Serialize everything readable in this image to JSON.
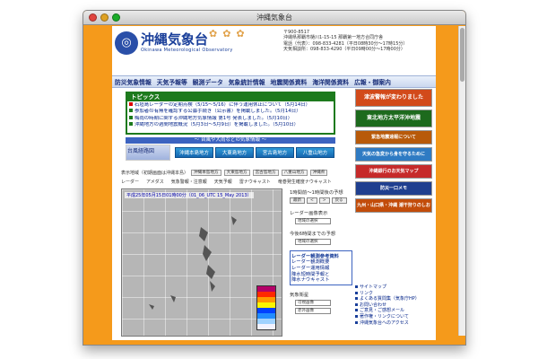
{
  "window": {
    "title": "沖縄気象台"
  },
  "header": {
    "title": "沖縄気象台",
    "subtitle": "Okinawa Meteorological Observatory",
    "contact_lines": [
      "〒900-8517",
      "沖縄県那覇市樋川1-15-15  那覇第一地方合同庁舎",
      "電話（代表）：098-833-4281（平日08時30分〜17時15分）",
      "天気相談所：098-833-4290（平日09時00分〜17時00分）"
    ]
  },
  "nav": {
    "items": [
      "防災気象情報",
      "天気予報等",
      "観測データ",
      "気象統計情報",
      "地震関係資料",
      "海洋関係資料",
      "広報・御案内"
    ]
  },
  "topics": {
    "heading": "トピックス",
    "items": [
      "石垣島レーダーの定期点検（5/15〜5/16）に伴う運用休止について（5月14日）",
      "参加者の有無を確認する公募手続き（公示書）を掲載しました。（5月14日）",
      "梅雨の時期に関する沖縄地方気象情報 第1号 発表しました。（5月10日）",
      "沖縄地方の週間地震概況（5月3日〜5月9日）を掲載しました。（5月10日）"
    ]
  },
  "typhoon": {
    "banner": "〜 台風や大雨などの気象情報 〜",
    "link_label": "台風経路図",
    "regions": [
      "沖縄本島地方",
      "大東島地方",
      "宮古島地方",
      "八重山地方"
    ]
  },
  "area_select": {
    "label": "表示地域（初期画面は沖縄本島）",
    "buttons": [
      "沖縄本島地方",
      "大東島地方",
      "宮古島地方",
      "八重山地方",
      "沖縄県"
    ]
  },
  "menu_row": [
    "レーダー",
    "アメダス",
    "気象警報・注意報",
    "天気予報",
    "雷ナウキャスト",
    "竜巻発生確度ナウキャスト"
  ],
  "map": {
    "stamp": "平成25年05月15日01時00分（01_06_UTC 15_May 2013）"
  },
  "side_controls": {
    "forecast_label": "1時間前〜1時間後の予想",
    "buttons": [
      "最新",
      "<",
      ">",
      "戻る"
    ],
    "radar_display": "レーダー画像表示",
    "select_1": "地域の選択",
    "forecast_6h": "今後6時間までの予想",
    "select_2": "地域の選択",
    "radar_ref_title": "レーダー観測参考資料",
    "radar_ref_links": [
      "レーダー観測概要",
      "レーダー運用情報",
      "降水短時間予報と",
      "降水ナウキャスト"
    ],
    "weather_select_label": "気象衛星",
    "select_3": "可視画像",
    "select_4": "赤外画像"
  },
  "right_ads": [
    {
      "label": "津波警報が変わりました",
      "color": "#d24a1a"
    },
    {
      "label": "東北地方太平洋沖地震",
      "color": "#1d6a1d"
    },
    {
      "label": "緊急地震速報について",
      "color": "#b85a0a"
    },
    {
      "label": "天気の急変から身を守るために",
      "color": "#2f7bc3"
    },
    {
      "label": "沖縄銀行のお天気マップ",
      "color": "#c62a2a"
    },
    {
      "label": "防災一口メモ",
      "color": "#1f3f8f"
    },
    {
      "label": "九州・山口県・沖縄 潮干狩りのしおり",
      "color": "#c24c0a"
    }
  ],
  "right_links": [
    "サイトマップ",
    "リンク",
    "よくある質問集（気象庁HP）",
    "お問い合わせ",
    "ご意見・ご感想メール",
    "著作権・リンクについて",
    "沖縄気象台へのアクセス"
  ]
}
